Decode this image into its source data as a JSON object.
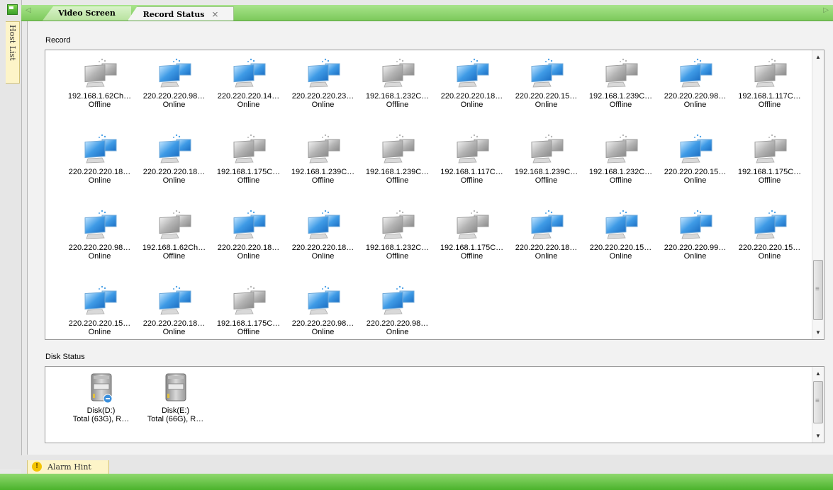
{
  "header": {
    "tabs": [
      {
        "label": "Video Screen"
      },
      {
        "label": "Record Status",
        "close": "×"
      }
    ]
  },
  "sidebar": {
    "host_list_label": "Host List"
  },
  "record": {
    "label": "Record",
    "hosts": [
      {
        "name": "192.168.1.62Ch…",
        "status": "Offline"
      },
      {
        "name": "220.220.220.98…",
        "status": "Online"
      },
      {
        "name": "220.220.220.14…",
        "status": "Online"
      },
      {
        "name": "220.220.220.23…",
        "status": "Online"
      },
      {
        "name": "192.168.1.232C…",
        "status": "Offline"
      },
      {
        "name": "220.220.220.18…",
        "status": "Online"
      },
      {
        "name": "220.220.220.15…",
        "status": "Online"
      },
      {
        "name": "192.168.1.239C…",
        "status": "Offline"
      },
      {
        "name": "220.220.220.98…",
        "status": "Online"
      },
      {
        "name": "192.168.1.117C…",
        "status": "Offline"
      },
      {
        "name": "220.220.220.18…",
        "status": "Online"
      },
      {
        "name": "220.220.220.18…",
        "status": "Online"
      },
      {
        "name": "192.168.1.175C…",
        "status": "Offline"
      },
      {
        "name": "192.168.1.239C…",
        "status": "Offline"
      },
      {
        "name": "192.168.1.239C…",
        "status": "Offline"
      },
      {
        "name": "192.168.1.117C…",
        "status": "Offline"
      },
      {
        "name": "192.168.1.239C…",
        "status": "Offline"
      },
      {
        "name": "192.168.1.232C…",
        "status": "Offline"
      },
      {
        "name": "220.220.220.15…",
        "status": "Online"
      },
      {
        "name": "192.168.1.175C…",
        "status": "Offline"
      },
      {
        "name": "220.220.220.98…",
        "status": "Online"
      },
      {
        "name": "192.168.1.62Ch…",
        "status": "Offline"
      },
      {
        "name": "220.220.220.18…",
        "status": "Online"
      },
      {
        "name": "220.220.220.18…",
        "status": "Online"
      },
      {
        "name": "192.168.1.232C…",
        "status": "Offline"
      },
      {
        "name": "192.168.1.175C…",
        "status": "Offline"
      },
      {
        "name": "220.220.220.18…",
        "status": "Online"
      },
      {
        "name": "220.220.220.15…",
        "status": "Online"
      },
      {
        "name": "220.220.220.99…",
        "status": "Online"
      },
      {
        "name": "220.220.220.15…",
        "status": "Online"
      },
      {
        "name": "220.220.220.15…",
        "status": "Online"
      },
      {
        "name": "220.220.220.18…",
        "status": "Online"
      },
      {
        "name": "192.168.1.175C…",
        "status": "Offline"
      },
      {
        "name": "220.220.220.98…",
        "status": "Online"
      },
      {
        "name": "220.220.220.98…",
        "status": "Online"
      }
    ]
  },
  "disk_status": {
    "label": "Disk Status",
    "disks": [
      {
        "name": "Disk(D:)",
        "total": "Total (63G), R…"
      },
      {
        "name": "Disk(E:)",
        "total": "Total (66G), R…"
      }
    ]
  },
  "alarm": {
    "label": "Alarm Hint",
    "icon": "!"
  },
  "colors": {
    "online": "#3a8fdc",
    "offline": "#a8a8a8",
    "green_bar": "#7cc95b"
  }
}
